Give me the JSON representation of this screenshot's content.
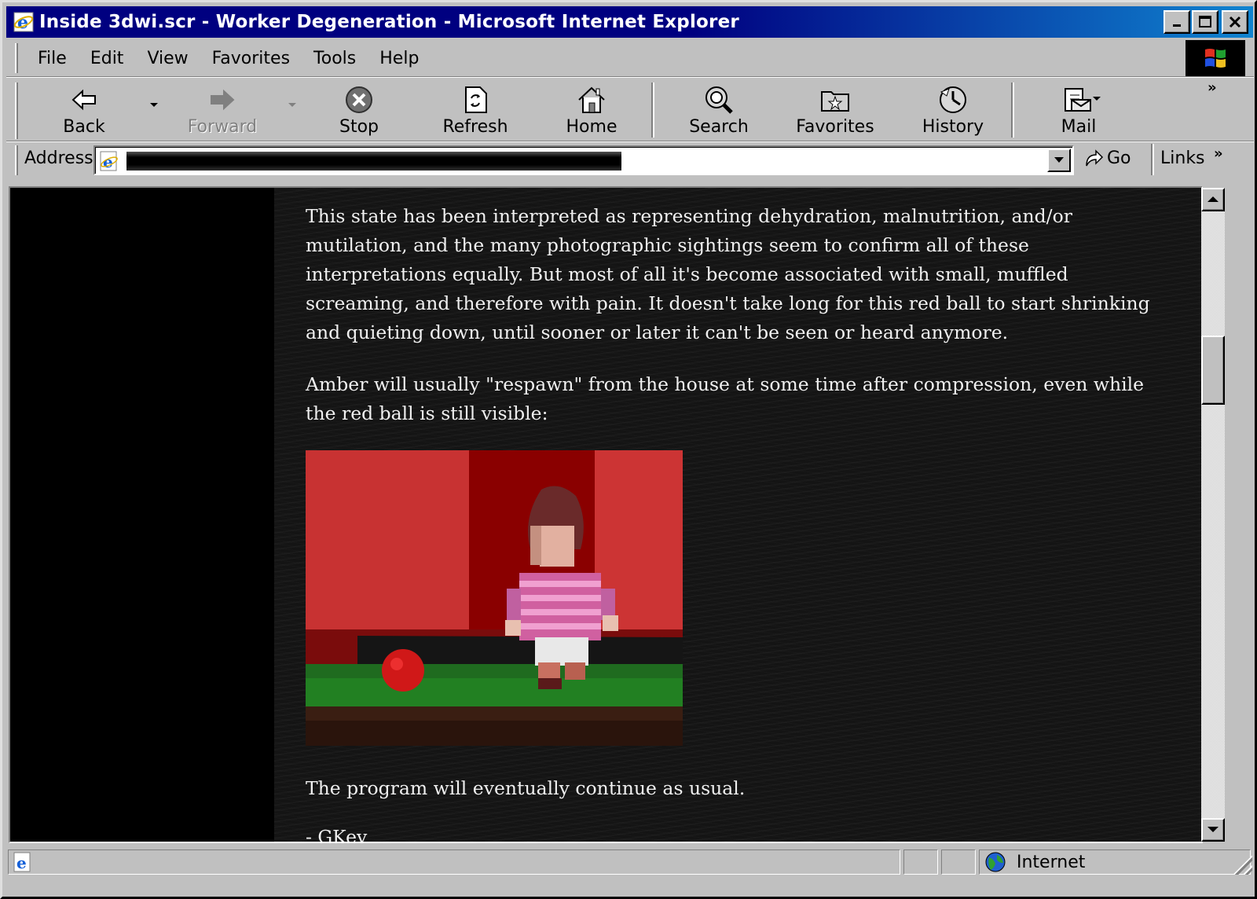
{
  "window": {
    "title": "Inside 3dwi.scr - Worker Degeneration - Microsoft Internet Explorer"
  },
  "menu": {
    "items": [
      "File",
      "Edit",
      "View",
      "Favorites",
      "Tools",
      "Help"
    ]
  },
  "toolbar": {
    "back": "Back",
    "forward": "Forward",
    "stop": "Stop",
    "refresh": "Refresh",
    "home": "Home",
    "search": "Search",
    "favorites": "Favorites",
    "history": "History",
    "mail": "Mail"
  },
  "address": {
    "label": "Address",
    "go": "Go",
    "links": "Links"
  },
  "content": {
    "paragraph1": "This state has been interpreted as representing dehydration, malnutrition, and/or mutilation, and the many photographic sightings seem to confirm all of these interpretations equally. But most of all it's become associated with small, muffled screaming, and therefore with pain. It doesn't take long for this red ball to start shrinking and quieting down, until sooner or later it can't be seen or heard anymore.",
    "paragraph2": "Amber will usually \"respawn\" from the house at some time after compression, even while the red ball is still visible:",
    "paragraph3": "The program will eventually continue as usual.",
    "signature": "- GKey"
  },
  "status": {
    "zone": "Internet"
  }
}
